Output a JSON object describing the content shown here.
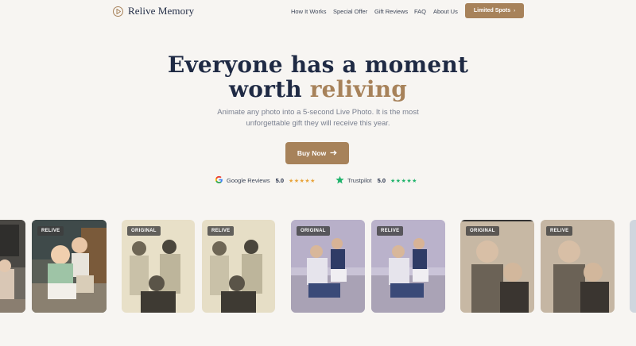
{
  "brand": {
    "name": "Relive Memory",
    "icon": "play-circle-icon"
  },
  "nav": {
    "items": [
      {
        "label": "How It Works"
      },
      {
        "label": "Special Offer"
      },
      {
        "label": "Gift Reviews"
      },
      {
        "label": "FAQ"
      },
      {
        "label": "About Us"
      }
    ],
    "cta": {
      "label": "Limited Spots",
      "icon": "chevron-right-icon"
    }
  },
  "hero": {
    "title_line1": "Everyone has a moment",
    "title_line2_plain": "worth",
    "title_line2_accent": "reliving",
    "subtitle_line1": "Animate any photo into a 5-second Live Photo. It is the most",
    "subtitle_line2": "unforgettable gift they will receive this year.",
    "buy_label": "Buy Now",
    "buy_icon": "arrow-right-icon"
  },
  "reviews": {
    "google": {
      "label": "Google Reviews",
      "score": "5.0",
      "stars": "★★★★★",
      "icon": "google-icon"
    },
    "trustpilot": {
      "label": "Trustpilot",
      "score": "5.0",
      "stars": "★★★★★",
      "icon": "trustpilot-star-icon"
    }
  },
  "gallery": {
    "badges": {
      "original": "ORIGINAL",
      "relive": "RELIVE"
    }
  },
  "colors": {
    "accent": "#a7825a",
    "text_dark": "#1f2a44",
    "background": "#f7f5f2",
    "star_gold": "#e8a33a",
    "trustpilot_green": "#1fb36b"
  }
}
